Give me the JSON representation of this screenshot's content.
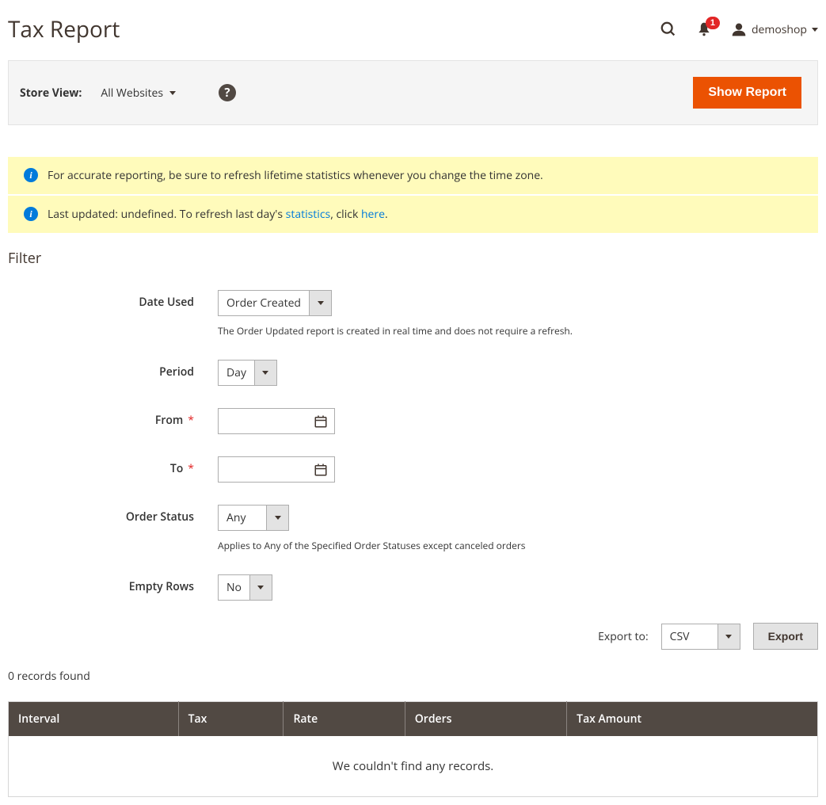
{
  "header": {
    "title": "Tax Report",
    "notif_count": "1",
    "username": "demoshop"
  },
  "toolbar": {
    "store_view_label": "Store View:",
    "store_view_value": "All Websites",
    "show_report_label": "Show Report"
  },
  "messages": {
    "msg1": "For accurate reporting, be sure to refresh lifetime statistics whenever you change the time zone.",
    "msg2_pre": "Last updated: undefined. To refresh last day's ",
    "msg2_link1": "statistics",
    "msg2_mid": ", click ",
    "msg2_link2": "here",
    "msg2_post": "."
  },
  "filter": {
    "heading": "Filter",
    "date_used_label": "Date Used",
    "date_used_value": "Order Created",
    "date_used_note": "The Order Updated report is created in real time and does not require a refresh.",
    "period_label": "Period",
    "period_value": "Day",
    "from_label": "From",
    "from_value": "",
    "to_label": "To",
    "to_value": "",
    "order_status_label": "Order Status",
    "order_status_value": "Any",
    "order_status_note": "Applies to Any of the Specified Order Statuses except canceled orders",
    "empty_rows_label": "Empty Rows",
    "empty_rows_value": "No"
  },
  "export": {
    "label": "Export to:",
    "format_value": "CSV",
    "button_label": "Export"
  },
  "grid": {
    "records_found": "0 records found",
    "columns": [
      "Interval",
      "Tax",
      "Rate",
      "Orders",
      "Tax Amount"
    ],
    "empty_text": "We couldn't find any records."
  }
}
